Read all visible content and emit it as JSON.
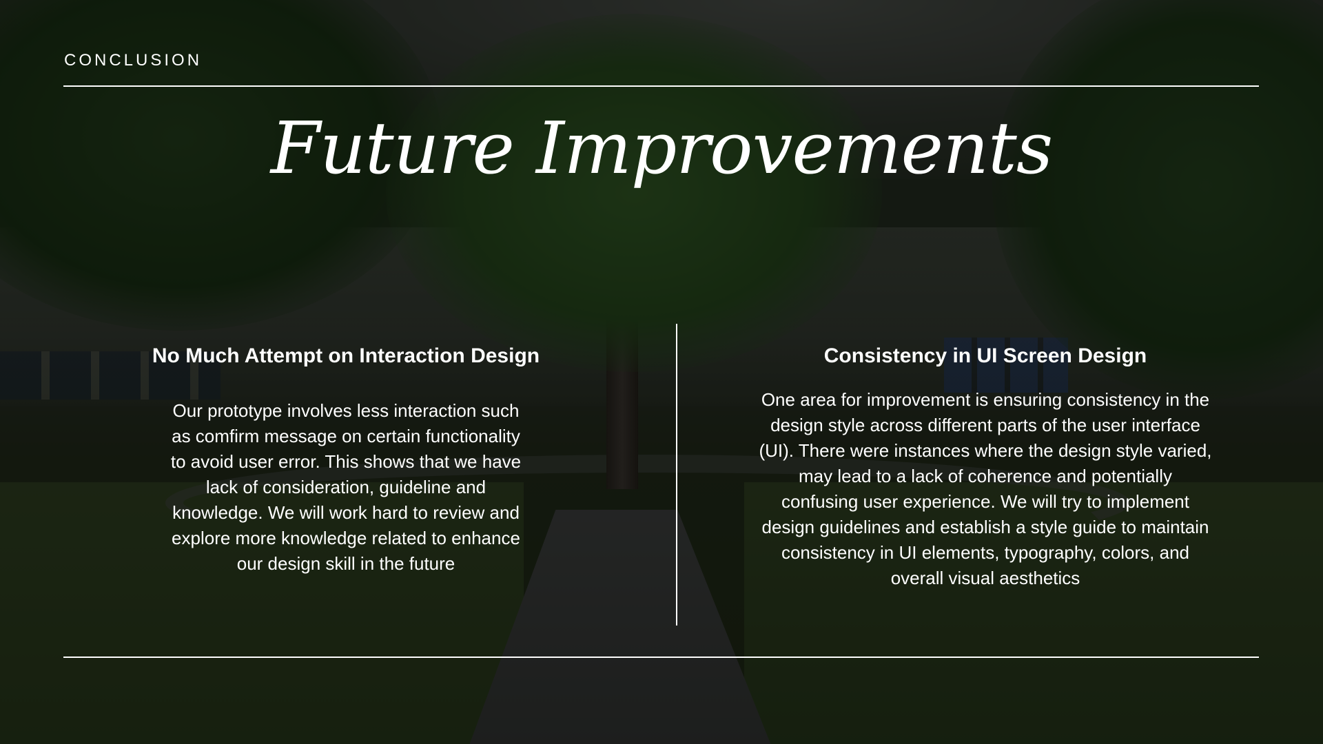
{
  "slide": {
    "section_label": "CONCLUSION",
    "title": "Future Improvements"
  },
  "columns": [
    {
      "heading": "No Much Attempt on Interaction Design",
      "body": "Our prototype involves less interaction such as comfirm message on certain functionality to avoid user error. This shows that we have lack of consideration, guideline and knowledge. We will work hard to review and explore more knowledge related to enhance our design skill in the future"
    },
    {
      "heading": "Consistency in UI Screen Design",
      "body": "One area for improvement is ensuring consistency in the design style across different parts of the user interface (UI). There were instances where the design style varied, may lead to a lack of coherence and potentially confusing user experience. We will try to implement design guidelines and establish a style guide to maintain consistency in UI elements, typography, colors, and overall visual aesthetics"
    }
  ],
  "colors": {
    "text": "#ffffff",
    "overlay": "#000000"
  }
}
